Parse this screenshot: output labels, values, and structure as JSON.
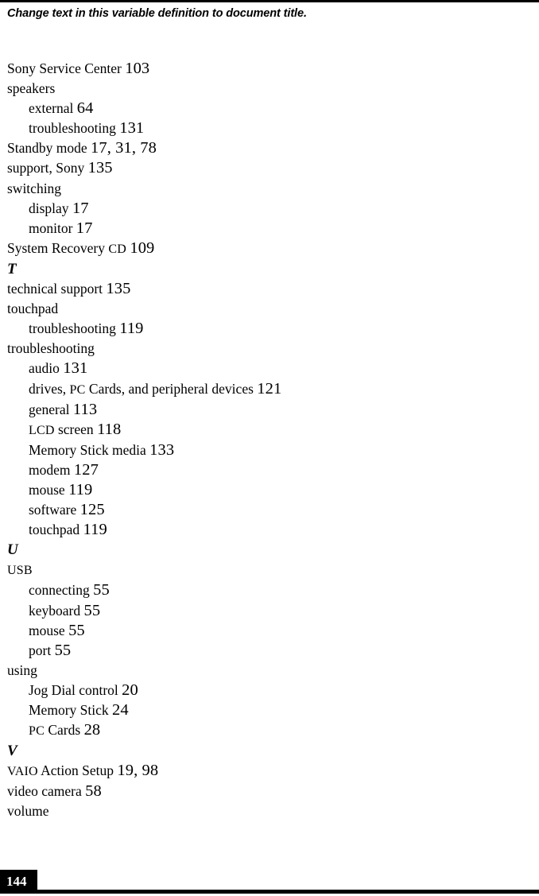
{
  "document": {
    "header_note": "Change text in this variable definition to document title.",
    "folio": "144"
  },
  "index": {
    "entries": [
      {
        "level": 0,
        "text": "Sony Service Center",
        "pages": "103"
      },
      {
        "level": 0,
        "text": "speakers",
        "pages": ""
      },
      {
        "level": 1,
        "text": "external",
        "pages": "64"
      },
      {
        "level": 1,
        "text": "troubleshooting",
        "pages": "131"
      },
      {
        "level": 0,
        "text": "Standby mode",
        "pages": "17, 31, 78"
      },
      {
        "level": 0,
        "text": "support, Sony",
        "pages": "135"
      },
      {
        "level": 0,
        "text": "switching",
        "pages": ""
      },
      {
        "level": 1,
        "text": "display",
        "pages": "17"
      },
      {
        "level": 1,
        "text": "monitor",
        "pages": "17"
      },
      {
        "level": 0,
        "text": "System Recovery CD",
        "pages": "109"
      },
      {
        "level": "letter",
        "text": "T",
        "pages": ""
      },
      {
        "level": 0,
        "text": "technical support",
        "pages": "135"
      },
      {
        "level": 0,
        "text": "touchpad",
        "pages": ""
      },
      {
        "level": 1,
        "text": "troubleshooting",
        "pages": "119"
      },
      {
        "level": 0,
        "text": "troubleshooting",
        "pages": ""
      },
      {
        "level": 1,
        "text": "audio",
        "pages": "131"
      },
      {
        "level": 1,
        "text": "drives, PC Cards, and peripheral devices",
        "pages": "121"
      },
      {
        "level": 1,
        "text": "general",
        "pages": "113"
      },
      {
        "level": 1,
        "text": "LCD screen",
        "pages": "118"
      },
      {
        "level": 1,
        "text": "Memory Stick media",
        "pages": "133"
      },
      {
        "level": 1,
        "text": "modem",
        "pages": "127"
      },
      {
        "level": 1,
        "text": "mouse",
        "pages": "119"
      },
      {
        "level": 1,
        "text": "software",
        "pages": "125"
      },
      {
        "level": 1,
        "text": "touchpad",
        "pages": "119"
      },
      {
        "level": "letter",
        "text": "U",
        "pages": ""
      },
      {
        "level": 0,
        "text": "USB",
        "pages": ""
      },
      {
        "level": 1,
        "text": "connecting",
        "pages": "55"
      },
      {
        "level": 1,
        "text": "keyboard",
        "pages": "55"
      },
      {
        "level": 1,
        "text": "mouse",
        "pages": "55"
      },
      {
        "level": 1,
        "text": "port",
        "pages": "55"
      },
      {
        "level": 0,
        "text": "using",
        "pages": ""
      },
      {
        "level": 1,
        "text": "Jog Dial control",
        "pages": "20"
      },
      {
        "level": 1,
        "text": "Memory Stick",
        "pages": "24"
      },
      {
        "level": 1,
        "text": "PC Cards",
        "pages": "28"
      },
      {
        "level": "letter",
        "text": "V",
        "pages": ""
      },
      {
        "level": 0,
        "text": "VAIO Action Setup",
        "pages": "19, 98"
      },
      {
        "level": 0,
        "text": "video camera",
        "pages": "58"
      },
      {
        "level": 0,
        "text": "volume",
        "pages": ""
      }
    ]
  }
}
